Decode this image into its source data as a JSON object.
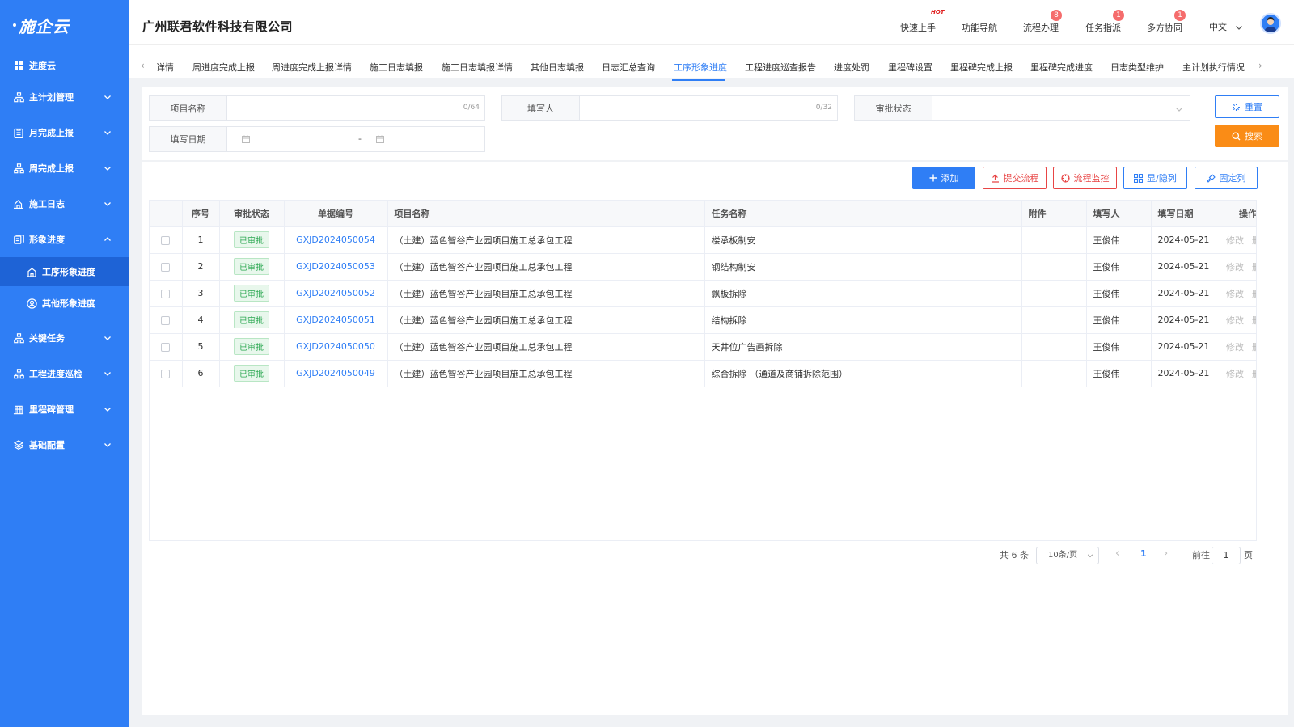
{
  "brand": {
    "logo": "施企云"
  },
  "sidebar": {
    "items": [
      {
        "label": "进度云",
        "icon": "grid-icon"
      },
      {
        "label": "主计划管理",
        "icon": "org-icon"
      },
      {
        "label": "月完成上报",
        "icon": "clipboard-icon"
      },
      {
        "label": "周完成上报",
        "icon": "org-icon"
      },
      {
        "label": "施工日志",
        "icon": "log-icon"
      },
      {
        "label": "形象进度",
        "icon": "list-icon"
      },
      {
        "label": "关键任务",
        "icon": "org-icon"
      },
      {
        "label": "工程进度巡检",
        "icon": "org-icon"
      },
      {
        "label": "里程碑管理",
        "icon": "milestone-icon"
      },
      {
        "label": "基础配置",
        "icon": "layers-icon"
      }
    ],
    "sub": [
      {
        "label": "工序形象进度",
        "icon": "building-icon"
      },
      {
        "label": "其他形象进度",
        "icon": "user-circle-icon"
      }
    ]
  },
  "header": {
    "company": "广州联君软件科技有限公司",
    "menus": [
      {
        "label": "快速上手",
        "badge": "HOT"
      },
      {
        "label": "功能导航",
        "badge": ""
      },
      {
        "label": "流程办理",
        "badge": "8"
      },
      {
        "label": "任务指派",
        "badge": "1"
      },
      {
        "label": "多方协同",
        "badge": "1"
      }
    ],
    "language": "中文"
  },
  "tabs": [
    "详情",
    "周进度完成上报",
    "周进度完成上报详情",
    "施工日志填报",
    "施工日志填报详情",
    "其他日志填报",
    "日志汇总查询",
    "工序形象进度",
    "工程进度巡查报告",
    "进度处罚",
    "里程碑设置",
    "里程碑完成上报",
    "里程碑完成进度",
    "日志类型维护",
    "主计划执行情况"
  ],
  "active_tab": "工序形象进度",
  "filters": {
    "project_name_label": "项目名称",
    "project_name_value": "",
    "project_name_counter": "0/64",
    "filler_label": "填写人",
    "filler_value": "",
    "filler_counter": "0/32",
    "status_label": "审批状态",
    "status_value": "",
    "date_label": "填写日期",
    "date_sep": "-"
  },
  "buttons": {
    "reset": "重置",
    "search": "搜索",
    "add": "添加",
    "submit_flow": "提交流程",
    "monitor_flow": "流程监控",
    "toggle_cols": "显/隐列",
    "fix_cols": "固定列"
  },
  "table": {
    "headers": [
      "序号",
      "审批状态",
      "单据编号",
      "项目名称",
      "任务名称",
      "附件",
      "填写人",
      "填写日期",
      "操作"
    ],
    "rows": [
      {
        "no": "1",
        "status": "已审批",
        "code": "GXJD2024050054",
        "project": "（土建）蓝色智谷产业园项目施工总承包工程",
        "task": "楼承板制安",
        "attach": "",
        "filler": "王俊伟",
        "date": "2024-05-21"
      },
      {
        "no": "2",
        "status": "已审批",
        "code": "GXJD2024050053",
        "project": "（土建）蓝色智谷产业园项目施工总承包工程",
        "task": "钢结构制安",
        "attach": "",
        "filler": "王俊伟",
        "date": "2024-05-21"
      },
      {
        "no": "3",
        "status": "已审批",
        "code": "GXJD2024050052",
        "project": "（土建）蓝色智谷产业园项目施工总承包工程",
        "task": "飘板拆除",
        "attach": "",
        "filler": "王俊伟",
        "date": "2024-05-21"
      },
      {
        "no": "4",
        "status": "已审批",
        "code": "GXJD2024050051",
        "project": "（土建）蓝色智谷产业园项目施工总承包工程",
        "task": "结构拆除",
        "attach": "",
        "filler": "王俊伟",
        "date": "2024-05-21"
      },
      {
        "no": "5",
        "status": "已审批",
        "code": "GXJD2024050050",
        "project": "（土建）蓝色智谷产业园项目施工总承包工程",
        "task": "天井位广告画拆除",
        "attach": "",
        "filler": "王俊伟",
        "date": "2024-05-21"
      },
      {
        "no": "6",
        "status": "已审批",
        "code": "GXJD2024050049",
        "project": "（土建）蓝色智谷产业园项目施工总承包工程",
        "task": "综合拆除 （通道及商铺拆除范围）",
        "attach": "",
        "filler": "王俊伟",
        "date": "2024-05-21"
      }
    ],
    "op_edit": "修改",
    "op_delete": "删除"
  },
  "pagination": {
    "total": "共 6 条",
    "page_size": "10条/页",
    "current": "1",
    "goto_prefix": "前往",
    "goto_value": "1",
    "goto_suffix": "页"
  }
}
